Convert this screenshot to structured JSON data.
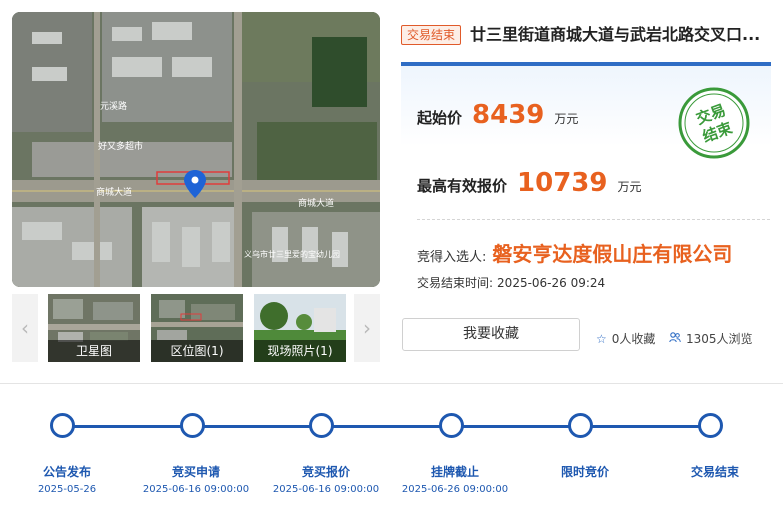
{
  "status_tag": "交易结束",
  "title": "廿三里街道商城大道与武岩北路交叉口...",
  "map": {
    "labels": {
      "road1": "元溪路",
      "road2": "商城大道",
      "road3": "商城大道",
      "shop": "好又多超市",
      "school": "义乌市廿三里爱的宝幼儿园"
    }
  },
  "thumbs": [
    {
      "caption": "卫星图"
    },
    {
      "caption": "区位图(1)"
    },
    {
      "caption": "现场照片(1)"
    }
  ],
  "nav": {
    "prev": "‹",
    "next": "›"
  },
  "price": {
    "start_label": "起始价",
    "start_value": "8439",
    "start_unit": "万元",
    "high_label": "最高有效报价",
    "high_value": "10739",
    "high_unit": "万元"
  },
  "stamp": {
    "line1": "交易",
    "line2": "结束"
  },
  "winner": {
    "label": "竞得入选人:",
    "value": "磐安亨达度假山庄有限公司"
  },
  "end_time": {
    "label": "交易结束时间:",
    "value": "2025-06-26 09:24"
  },
  "favorite_button": "我要收藏",
  "stats": {
    "favorites": "0人收藏",
    "views": "1305人浏览"
  },
  "timeline": [
    {
      "label": "公告发布",
      "date": "2025-05-26"
    },
    {
      "label": "竞买申请",
      "date": "2025-06-16 09:00:00"
    },
    {
      "label": "竞买报价",
      "date": "2025-06-16 09:00:00"
    },
    {
      "label": "挂牌截止",
      "date": "2025-06-26 09:00:00"
    },
    {
      "label": "限时竞价",
      "date": ""
    },
    {
      "label": "交易结束",
      "date": ""
    }
  ],
  "colors": {
    "accent": "#e8611f",
    "primary": "#1e58b0",
    "stamp": "#3a9a3a"
  }
}
